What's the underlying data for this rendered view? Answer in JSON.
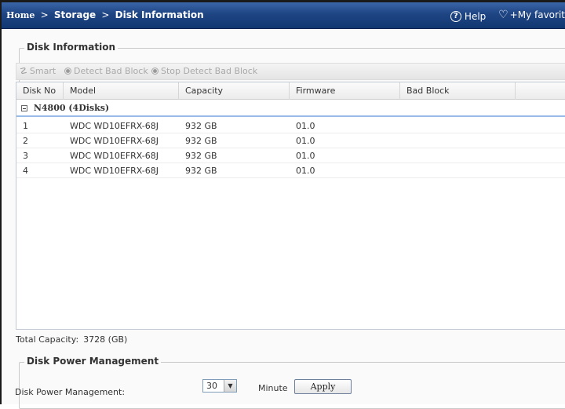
{
  "header": {
    "breadcrumb": {
      "home": "Home",
      "sep1": ">",
      "storage": "Storage",
      "sep2": ">",
      "current": "Disk Information"
    },
    "help_label": "Help",
    "favorite_label": "My favorit"
  },
  "disk_info": {
    "legend": "Disk Information",
    "toolbar": {
      "smart_label": "Smart",
      "detect_label": "Detect Bad Block",
      "stop_label": "Stop Detect Bad Block"
    },
    "columns": [
      "Disk No",
      "Model",
      "Capacity",
      "Firmware",
      "Bad Block",
      ""
    ],
    "group_label": "N4800 (4Disks)",
    "rows": [
      {
        "disk_no": "1",
        "model": "WDC WD10EFRX-68J",
        "capacity": "932 GB",
        "firmware": "01.0",
        "bad_block": ""
      },
      {
        "disk_no": "2",
        "model": "WDC WD10EFRX-68J",
        "capacity": "932 GB",
        "firmware": "01.0",
        "bad_block": ""
      },
      {
        "disk_no": "3",
        "model": "WDC WD10EFRX-68J",
        "capacity": "932 GB",
        "firmware": "01.0",
        "bad_block": ""
      },
      {
        "disk_no": "4",
        "model": "WDC WD10EFRX-68J",
        "capacity": "932 GB",
        "firmware": "01.0",
        "bad_block": ""
      }
    ],
    "total_label": "Total Capacity:",
    "total_value": "3728 (GB)"
  },
  "power": {
    "legend": "Disk Power Management",
    "label": "Disk Power Management:",
    "selected_value": "30",
    "unit": "Minute",
    "apply_label": "Apply"
  },
  "icons": {
    "smart": "smart-icon",
    "detect": "radio-icon",
    "stop": "radio-icon",
    "help": "help-icon",
    "favorite": "heart-plus-icon",
    "collapse": "collapse-icon",
    "dropdown": "chevron-down-icon"
  },
  "colors": {
    "topbar": "#1e4483",
    "group_underline": "#99bbe8",
    "disabled_text": "#a9a9a9"
  }
}
